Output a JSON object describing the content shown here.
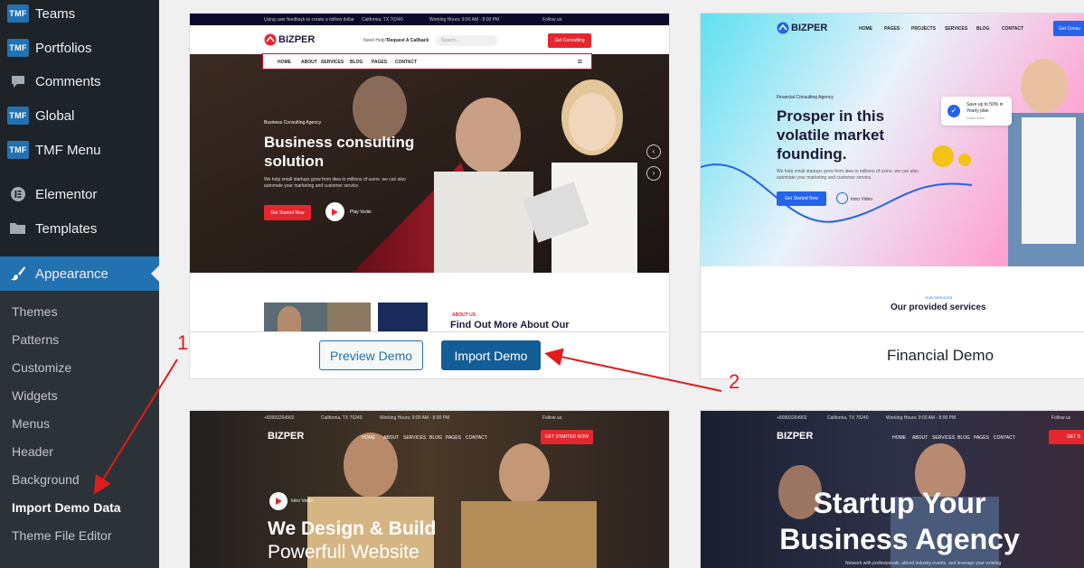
{
  "sidebar": {
    "top_items": [
      {
        "label": "Teams",
        "icon": "tmf-icon",
        "icon_text": "TMF"
      },
      {
        "label": "Portfolios",
        "icon": "tmf-icon",
        "icon_text": "TMF"
      },
      {
        "label": "Comments",
        "icon": "comment-icon"
      },
      {
        "label": "Global",
        "icon": "tmf-icon",
        "icon_text": "TMF"
      },
      {
        "label": "TMF Menu",
        "icon": "tmf-icon",
        "icon_text": "TMF"
      },
      {
        "label": "Elementor",
        "icon": "elementor-icon"
      },
      {
        "label": "Templates",
        "icon": "folder-icon"
      }
    ],
    "active_item": {
      "label": "Appearance",
      "icon": "paintbrush-icon"
    },
    "submenu": [
      "Themes",
      "Patterns",
      "Customize",
      "Widgets",
      "Menus",
      "Header",
      "Background",
      "Import Demo Data",
      "Theme File Editor"
    ],
    "current_submenu": "Import Demo Data"
  },
  "card1": {
    "preview_label": "Preview Demo",
    "import_label": "Import Demo",
    "shot": {
      "topbar_text": "Using user feedback to create a million dollar",
      "location": "California, TX 70240",
      "hours": "Working Hours: 9:00 AM - 8:00 PM",
      "follow": "Follow us:",
      "brand": "BIZPER",
      "help": "Need Help?",
      "callback": "Request A Callback",
      "search_placeholder": "Search...",
      "cta": "Get Consulting",
      "nav": [
        "HOME",
        "ABOUT",
        "SERVICES",
        "BLOG",
        "PAGES",
        "CONTACT"
      ],
      "eyebrow": "Business Consulting Agency",
      "title_line1": "Business consulting",
      "title_line2": "solution",
      "desc": "We help small startups grow from idea to millions of users. we can also automate your marketing and customer service.",
      "start_btn": "Get Started Now",
      "play": "Play Vedio",
      "about_tag": "ABOUT US",
      "about_title": "Find Out More About Our"
    }
  },
  "card2": {
    "name": "Financial Demo",
    "shot": {
      "brand": "BIZPER",
      "nav": [
        "HOME",
        "PAGES",
        "PROJECTS",
        "SERVICES",
        "BLOG",
        "CONTACT"
      ],
      "cta": "Get Consu",
      "eyebrow": "Financial Consulting Agency",
      "title_line1": "Prosper in this",
      "title_line2": "volatile market",
      "title_line3": "founding.",
      "desc": "We help small startups grow from idea to millions of users. we can also automate your marketing and customer service.",
      "start_btn": "Get Started Now",
      "intro": "Intro Video",
      "badge_line1": "Save up to 50% in",
      "badge_line2": "Yearly plan",
      "badge_line3": "Learn More",
      "services_tag": "OUR SERVICES",
      "services_title": "Our provided services"
    }
  },
  "card3": {
    "shot": {
      "phone": "+80993264902",
      "location": "California, TX 70240",
      "hours": "Working Hours: 9:00 AM - 8:00 PM",
      "follow": "Follow us:",
      "brand": "BIZPER",
      "nav": [
        "HOME",
        "ABOUT",
        "SERVICES",
        "BLOG",
        "PAGES",
        "CONTACT"
      ],
      "cta": "GET STARTED NOW",
      "intro": "Intro Vedio",
      "title_line1": "We Design & Build",
      "title_line2": "Powerfull Website"
    }
  },
  "card4": {
    "shot": {
      "phone": "+80993264902",
      "location": "California, TX 70240",
      "hours": "Working Hours: 9:00 AM - 8:00 PM",
      "follow": "Follow us",
      "brand": "BIZPER",
      "nav": [
        "HOME",
        "ABOUT",
        "SERVICES",
        "BLOG",
        "PAGES",
        "CONTACT"
      ],
      "cta": "GET S",
      "title_line1": "Startup Your",
      "title_line2": "Business Agency",
      "desc": "Network with professionals, attend industry events, and leverage your existing"
    }
  },
  "annotations": {
    "label1": "1",
    "label2": "2",
    "color": "#e01b1b"
  }
}
